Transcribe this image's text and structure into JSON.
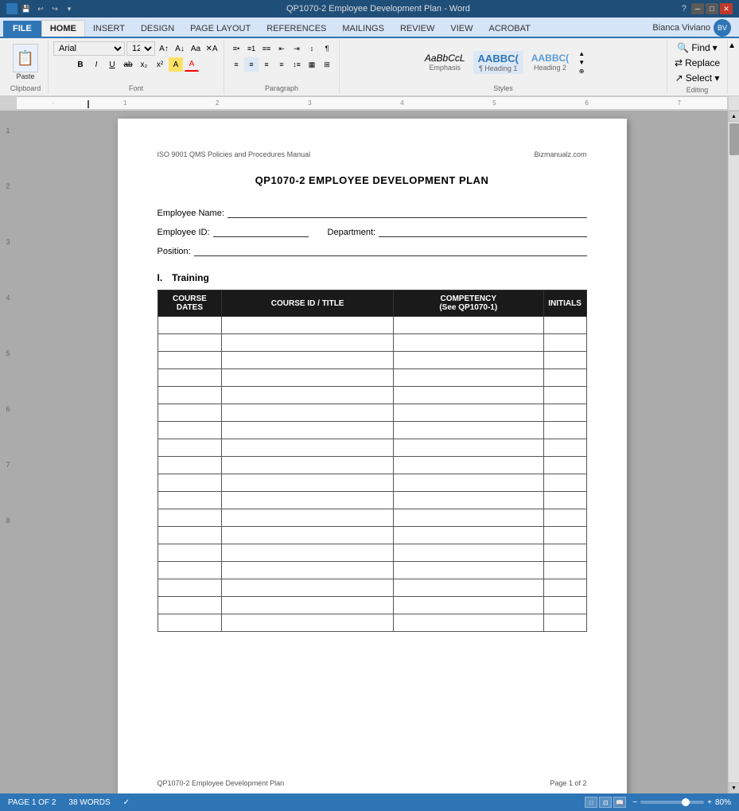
{
  "titlebar": {
    "title": "QP1070-2 Employee Development Plan - Word",
    "help_icon": "?",
    "minimize_label": "─",
    "maximize_label": "□",
    "close_label": "✕"
  },
  "ribbon": {
    "file_tab": "FILE",
    "tabs": [
      "HOME",
      "INSERT",
      "DESIGN",
      "PAGE LAYOUT",
      "REFERENCES",
      "MAILINGS",
      "REVIEW",
      "VIEW",
      "ACROBAT"
    ],
    "active_tab": "HOME",
    "font_name": "Arial",
    "font_size": "12",
    "paste_label": "Paste",
    "clipboard_label": "Clipboard",
    "font_label": "Font",
    "paragraph_label": "Paragraph",
    "styles_label": "Styles",
    "editing_label": "Editing",
    "find_label": "Find",
    "replace_label": "Replace",
    "select_label": "Select ▾",
    "style_emphasis": "AaBbCcL",
    "style_heading1": "AABBC(",
    "style_heading2": "AABBC(",
    "style_emphasis_name": "Emphasis",
    "style_h1_name": "¶ Heading 1",
    "style_h2_name": "Heading 2",
    "user_name": "Bianca Viviano"
  },
  "document": {
    "header_left": "ISO 9001 QMS Policies and Procedures Manual",
    "header_right": "Bizmanualz.com",
    "title": "QP1070-2 EMPLOYEE DEVELOPMENT PLAN",
    "employee_name_label": "Employee Name:",
    "employee_id_label": "Employee ID:",
    "department_label": "Department:",
    "position_label": "Position:",
    "section_number": "I.",
    "section_title": "Training",
    "table_headers": [
      "COURSE DATES",
      "COURSE ID / TITLE",
      "COMPETENCY\n(See QP1070-1)",
      "INITIALS"
    ],
    "table_rows": 18,
    "footer_left": "QP1070-2 Employee Development Plan",
    "footer_right": "Page 1 of 2"
  },
  "statusbar": {
    "page_info": "PAGE 1 OF 2",
    "word_count": "38 WORDS",
    "zoom_percent": "80%",
    "layout_icon": "□"
  },
  "ruler": {
    "marks": [
      "1",
      "2",
      "3",
      "4",
      "5",
      "6",
      "7"
    ]
  }
}
